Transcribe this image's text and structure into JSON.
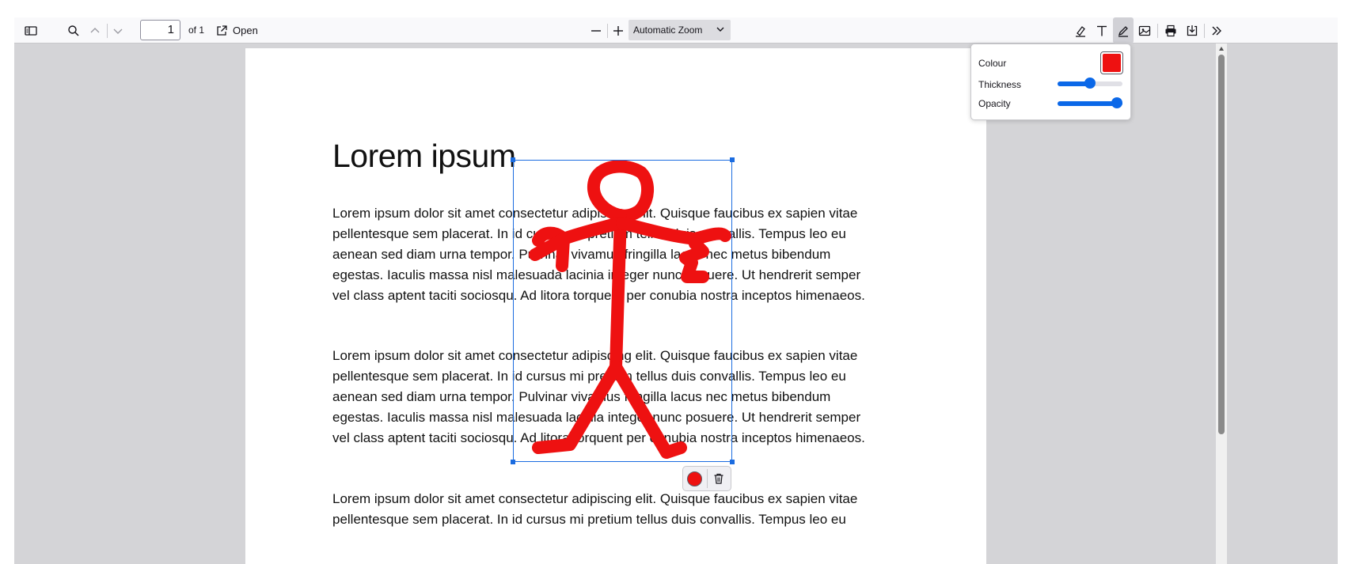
{
  "toolbar": {
    "page_number": "1",
    "page_count_label": "of 1",
    "open_label": "Open",
    "zoom_value": "Automatic Zoom"
  },
  "document": {
    "title": "Lorem ipsum",
    "paragraphs": [
      [
        "Lorem ipsum dolor sit amet consectetur adipiscing elit. Quisque faucibus ex sapien vitae",
        "pellentesque sem placerat. In id cursus mi pretium tellus duis convallis. Tempus leo eu",
        "aenean sed diam urna tempor. Pulvinar vivamus fringilla lacus nec metus bibendum",
        "egestas. Iaculis massa nisl malesuada lacinia integer nunc posuere. Ut hendrerit semper",
        "vel class aptent taciti sociosqu. Ad litora torquent per conubia nostra inceptos himenaeos."
      ],
      [
        "Lorem ipsum dolor sit amet consectetur adipiscing elit. Quisque faucibus ex sapien vitae",
        "pellentesque sem placerat. In id cursus mi pretium tellus duis convallis. Tempus leo eu",
        "aenean sed diam urna tempor. Pulvinar vivamus fringilla lacus nec metus bibendum",
        "egestas. Iaculis massa nisl malesuada lacinia integer nunc posuere. Ut hendrerit semper",
        "vel class aptent taciti sociosqu. Ad litora torquent per conubia nostra inceptos himenaeos."
      ],
      [
        "Lorem ipsum dolor sit amet consectetur adipiscing elit. Quisque faucibus ex sapien vitae",
        "pellentesque sem placerat. In id cursus mi pretium tellus duis convallis. Tempus leo eu"
      ]
    ]
  },
  "ink_popup": {
    "colour_label": "Colour",
    "thickness_label": "Thickness",
    "opacity_label": "Opacity",
    "colour_value": "#ee1111",
    "thickness_level": 0.5,
    "opacity_level": 1.0
  },
  "colors": {
    "ink": "#ee1111",
    "selection": "#1b6ce0",
    "accent": "#0b68e8"
  }
}
